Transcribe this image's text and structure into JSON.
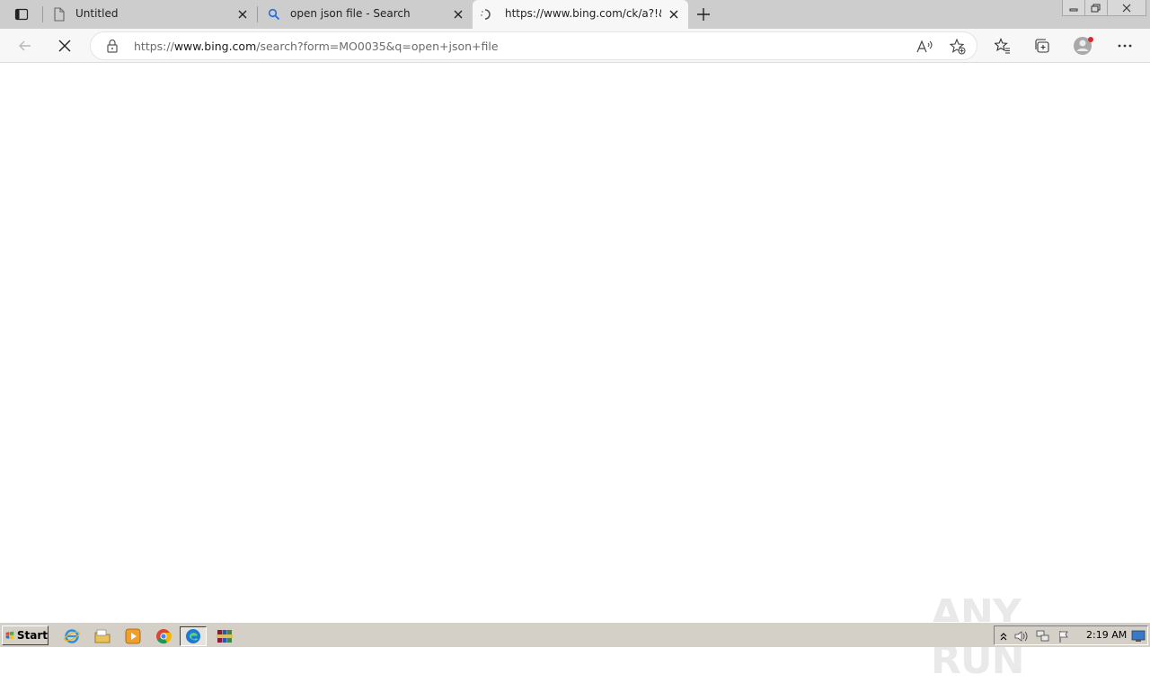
{
  "browser": {
    "tabs": [
      {
        "title": "Untitled",
        "favicon": "page-icon",
        "active": false
      },
      {
        "title": "open json file - Search",
        "favicon": "search-icon",
        "active": false
      },
      {
        "title": "https://www.bing.com/ck/a?!&&",
        "favicon": "loading-icon",
        "active": true
      }
    ],
    "address": {
      "scheme": "https://",
      "host": "www.bing.com",
      "path": "/search?form=MO0035&q=open+json+file"
    }
  },
  "watermark": {
    "text": "ANY RUN"
  },
  "taskbar": {
    "start_label": "Start",
    "clock": "2:19 AM"
  },
  "colors": {
    "tabstrip": "#cdcdcd",
    "toolbar": "#f7f7f7",
    "taskbar": "#d4d0c8",
    "accent_blue": "#1e6fd9"
  }
}
